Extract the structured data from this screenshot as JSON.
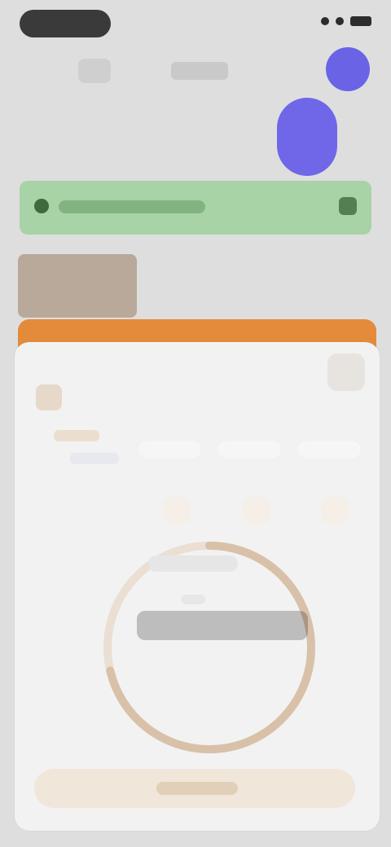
{
  "status": {},
  "header": {},
  "banner": {},
  "timer": {},
  "actions": {},
  "colors": {
    "purple": "#6a63e6",
    "green_banner": "#a7d3a6",
    "orange": "#e38b3b",
    "ring": "#d8c1a8"
  }
}
